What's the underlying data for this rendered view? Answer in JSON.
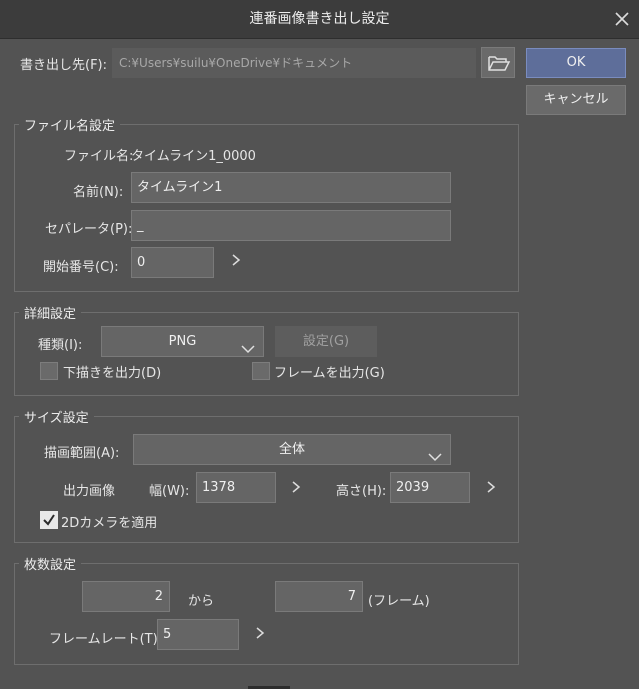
{
  "window": {
    "title": "連番画像書き出し設定"
  },
  "output": {
    "label": "書き出し先(F):",
    "path": "C:¥Users¥suilu¥OneDrive¥ドキュメント"
  },
  "buttons": {
    "ok": "OK",
    "cancel": "キャンセル"
  },
  "filename": {
    "group_title": "ファイル名設定",
    "preview_label": "ファイル名:",
    "preview_value": "タイムライン1_0000",
    "name_label": "名前(N):",
    "name_value": "タイムライン1",
    "separator_label": "セパレータ(P):",
    "separator_value": "_",
    "start_label": "開始番号(C):",
    "start_value": "0"
  },
  "detail": {
    "group_title": "詳細設定",
    "type_label": "種類(I):",
    "type_value": "PNG",
    "settings_button": "設定(G)",
    "draft_label": "下描きを出力(D)",
    "draft_checked": false,
    "frame_label": "フレームを出力(G)",
    "frame_checked": false
  },
  "size": {
    "group_title": "サイズ設定",
    "range_label": "描画範囲(A):",
    "range_value": "全体",
    "output_label": "出力画像",
    "width_label": "幅(W):",
    "width_value": "1378",
    "height_label": "高さ(H):",
    "height_value": "2039",
    "camera_label": "2Dカメラを適用",
    "camera_checked": true
  },
  "count": {
    "group_title": "枚数設定",
    "from_value": "2",
    "from_label": "から",
    "to_value": "7",
    "to_label": "(フレーム)",
    "rate_label": "フレームレート(T):",
    "rate_value": "5"
  },
  "icons": {
    "close": "close-icon",
    "folder": "folder-open-icon",
    "chevron": "chevron-right-icon",
    "dropdown": "chevron-down-icon",
    "check": "check-icon"
  },
  "colors": {
    "background": "#535353",
    "titlebar": "#3c3c3c",
    "primary_button": "#5e6e9a"
  }
}
